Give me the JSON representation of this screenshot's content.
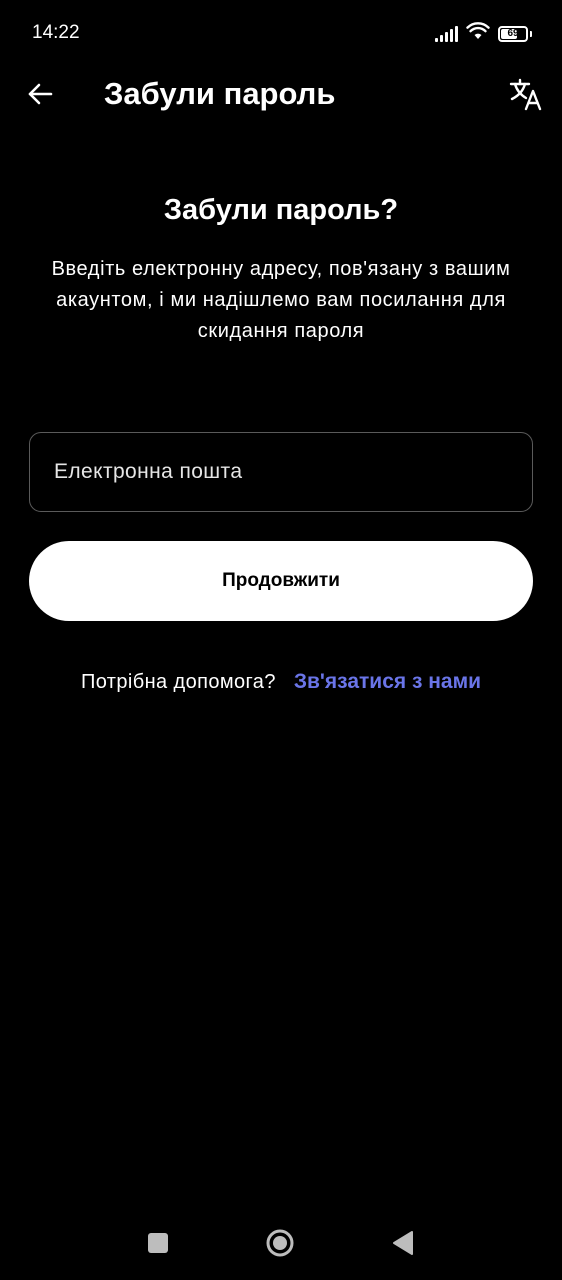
{
  "status_bar": {
    "time": "14:22",
    "battery_level": "69",
    "icons": [
      "signal-icon",
      "wifi-icon",
      "battery-icon"
    ]
  },
  "header": {
    "title": "Забули пароль",
    "back_icon": "arrow-left-icon",
    "translate_icon": "translate-icon"
  },
  "main": {
    "title": "Забули пароль?",
    "description": "Введіть електронну адресу, пов'язану з вашим акаунтом, і ми надішлемо вам посилання для скидання пароля",
    "email_field": {
      "value": "",
      "placeholder": "Електронна пошта"
    },
    "continue_label": "Продовжити",
    "help_text": "Потрібна допомога?",
    "contact_link": "Зв'язатися з нами"
  },
  "colors": {
    "background": "#000000",
    "text": "#ffffff",
    "link": "#6a75e8",
    "button_bg": "#ffffff",
    "input_border": "#5a5a5a"
  },
  "nav_bar": {
    "icons": [
      "recents-square-icon",
      "home-circle-icon",
      "back-triangle-icon"
    ]
  }
}
